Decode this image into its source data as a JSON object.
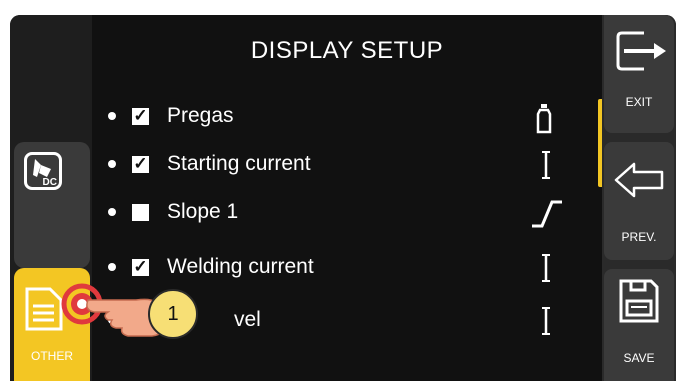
{
  "title": "DISPLAY SETUP",
  "left_panel": {
    "dc_button": {
      "badge": "DC"
    },
    "other_button": {
      "label": "OTHER"
    }
  },
  "list": [
    {
      "label": "Pregas",
      "checked": true,
      "icon": "gas-bottle-icon"
    },
    {
      "label": "Starting current",
      "checked": true,
      "icon": "current-bar-icon"
    },
    {
      "label": "Slope 1",
      "checked": false,
      "icon": "slope-icon"
    },
    {
      "label": "Welding current",
      "checked": true,
      "icon": "current-bar-icon"
    },
    {
      "label": "vel",
      "checked": true,
      "icon": "current-bar-icon"
    }
  ],
  "right_panel": {
    "exit_label": "EXIT",
    "prev_label": "PREV.",
    "save_label": "SAVE"
  },
  "annotation": {
    "step_number": "1"
  },
  "colors": {
    "accent": "#f3c623",
    "background": "#111111",
    "panel": "#3a3a3a",
    "callout": "#f7df75",
    "touch_ring": "#e0393d"
  }
}
